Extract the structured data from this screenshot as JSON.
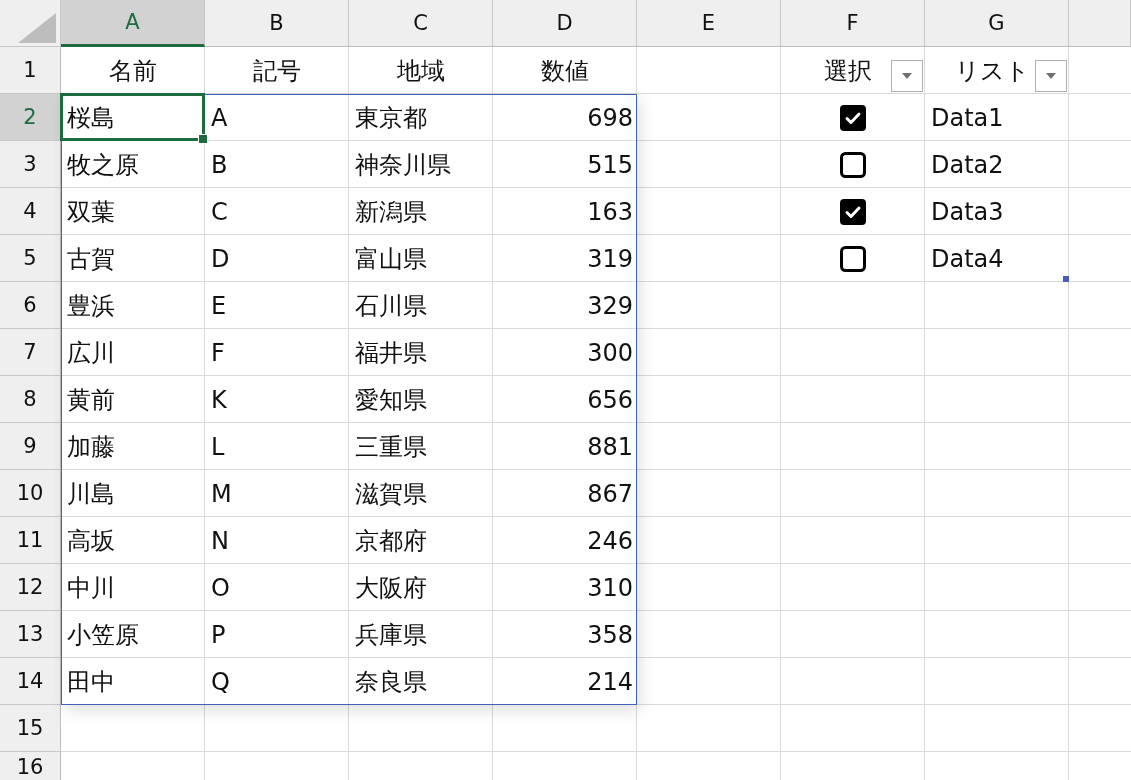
{
  "column_headers": [
    {
      "label": "A",
      "selected": true
    },
    {
      "label": "B",
      "selected": false
    },
    {
      "label": "C",
      "selected": false
    },
    {
      "label": "D",
      "selected": false
    },
    {
      "label": "E",
      "selected": false
    },
    {
      "label": "F",
      "selected": false
    },
    {
      "label": "G",
      "selected": false
    }
  ],
  "row_headers": [
    {
      "label": "1",
      "selected": false
    },
    {
      "label": "2",
      "selected": true
    },
    {
      "label": "3",
      "selected": false
    },
    {
      "label": "4",
      "selected": false
    },
    {
      "label": "5",
      "selected": false
    },
    {
      "label": "6",
      "selected": false
    },
    {
      "label": "7",
      "selected": false
    },
    {
      "label": "8",
      "selected": false
    },
    {
      "label": "9",
      "selected": false
    },
    {
      "label": "10",
      "selected": false
    },
    {
      "label": "11",
      "selected": false
    },
    {
      "label": "12",
      "selected": false
    },
    {
      "label": "13",
      "selected": false
    },
    {
      "label": "14",
      "selected": false
    },
    {
      "label": "15",
      "selected": false
    },
    {
      "label": "16",
      "selected": false
    }
  ],
  "table": {
    "columns": [
      "名前",
      "記号",
      "地域",
      "数値"
    ],
    "rows": [
      [
        "桜島",
        "A",
        "東京都",
        "698"
      ],
      [
        "牧之原",
        "B",
        "神奈川県",
        "515"
      ],
      [
        "双葉",
        "C",
        "新潟県",
        "163"
      ],
      [
        "古賀",
        "D",
        "富山県",
        "319"
      ],
      [
        "豊浜",
        "E",
        "石川県",
        "329"
      ],
      [
        "広川",
        "F",
        "福井県",
        "300"
      ],
      [
        "黄前",
        "K",
        "愛知県",
        "656"
      ],
      [
        "加藤",
        "L",
        "三重県",
        "881"
      ],
      [
        "川島",
        "M",
        "滋賀県",
        "867"
      ],
      [
        "高坂",
        "N",
        "京都府",
        "246"
      ],
      [
        "中川",
        "O",
        "大阪府",
        "310"
      ],
      [
        "小笠原",
        "P",
        "兵庫県",
        "358"
      ],
      [
        "田中",
        "Q",
        "奈良県",
        "214"
      ]
    ]
  },
  "checklist": {
    "header": "選択",
    "list_header": "リスト",
    "items": [
      {
        "checked": true,
        "label": "Data1"
      },
      {
        "checked": false,
        "label": "Data2"
      },
      {
        "checked": true,
        "label": "Data3"
      },
      {
        "checked": false,
        "label": "Data4"
      }
    ]
  }
}
